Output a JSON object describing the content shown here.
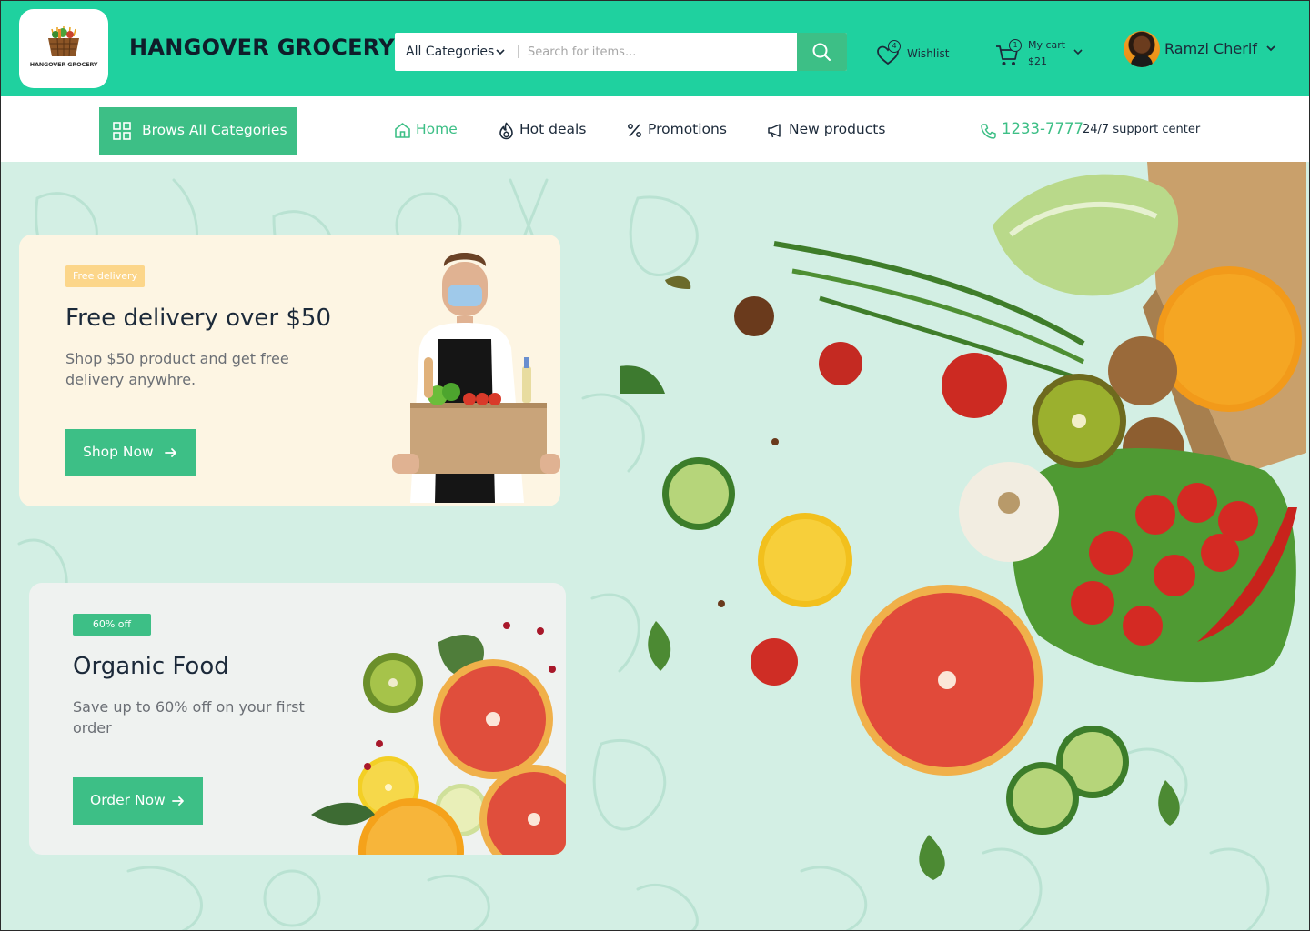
{
  "header": {
    "logo_text": "HANGOVER GROCERY",
    "brand": "HANGOVER GROCERY",
    "search": {
      "category": "All Categories",
      "placeholder": "Search for items..."
    },
    "wishlist": {
      "label": "Wishlist",
      "count": "4"
    },
    "cart": {
      "label": "My cart",
      "amount": "$21",
      "count": "1"
    },
    "user": {
      "name": "Ramzi Cherif"
    },
    "colors": {
      "primary": "#1fd19f",
      "accent": "#3dbf86",
      "text": "#1c2a3a"
    }
  },
  "nav": {
    "browse": "Brows All Categories",
    "items": [
      {
        "label": "Home",
        "icon": "home-icon"
      },
      {
        "label": "Hot deals",
        "icon": "flame-icon"
      },
      {
        "label": "Promotions",
        "icon": "percent-icon"
      },
      {
        "label": "New products",
        "icon": "megaphone-icon"
      }
    ],
    "support": {
      "phone": "1233-7777",
      "text": "24/7 support center"
    }
  },
  "hero": {
    "cards": [
      {
        "tag": "Free delivery",
        "title": "Free delivery over $50",
        "description": "Shop $50 product and get free delivery anywhre.",
        "cta": "Shop Now"
      },
      {
        "tag": "60% off",
        "title": "Organic Food",
        "description": "Save up to 60% off on your first order",
        "cta": "Order Now"
      }
    ]
  }
}
